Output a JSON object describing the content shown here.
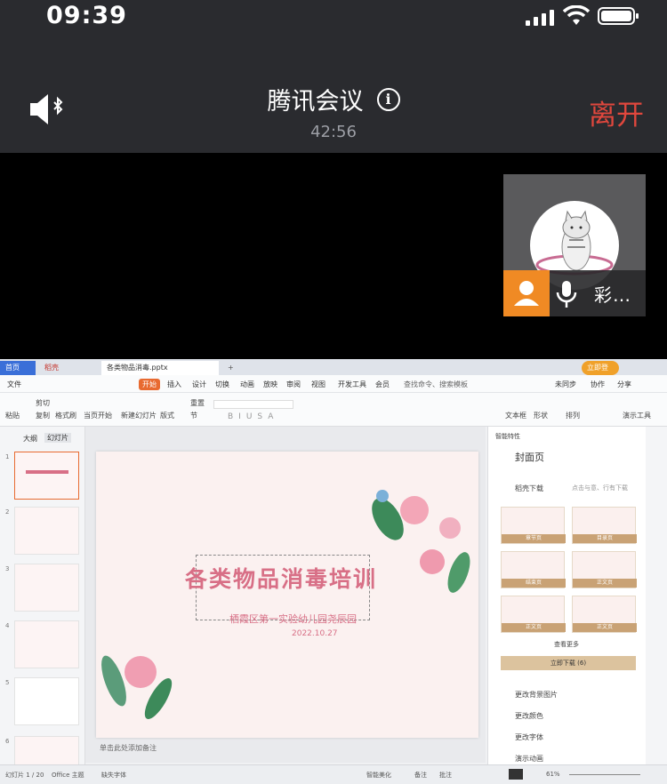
{
  "status_bar": {
    "time": "09:39"
  },
  "meeting": {
    "title": "腾讯会议",
    "info_glyph": "i",
    "duration": "42:56",
    "leave_label": "离开"
  },
  "participant": {
    "name": "彩…"
  },
  "wps": {
    "tabs": {
      "home": "首页",
      "daoke": "稻壳",
      "doc": "各类物品消毒.pptx",
      "add": "+",
      "login": "立即登录"
    },
    "menu": [
      "文件",
      "开始",
      "插入",
      "设计",
      "切换",
      "动画",
      "放映",
      "审阅",
      "视图",
      "开发工具",
      "会员"
    ],
    "search": "查找命令、搜索模板",
    "right_menu": [
      "未同步",
      "协作",
      "分享"
    ],
    "ribbon": [
      "粘贴",
      "剪切",
      "复制",
      "格式刷",
      "当页开始",
      "新建幻灯片",
      "版式",
      "节",
      "重置",
      "文本框",
      "形状",
      "排列",
      "演示工具"
    ],
    "view_tabs": [
      "大纲",
      "幻灯片"
    ],
    "slide": {
      "title": "各类物品消毒培训",
      "subtitle": "栖霞区第一实验幼儿园尧辰园",
      "date": "2022.10.27"
    },
    "notes_hint": "单击此处添加备注",
    "panel": {
      "heading": "智能特性",
      "section": "封面页",
      "filter": "稻壳下载",
      "filter_hint": "点击与意、行有下载",
      "cards": [
        "章节页",
        "目录页",
        "结束页",
        "正文页",
        "正文页",
        "正文页"
      ],
      "more": "查看更多",
      "download": "立即下载 (6)",
      "actions": [
        "更改背景图片",
        "更改颜色",
        "更改字体",
        "演示动画"
      ]
    },
    "status": {
      "slide_count": "幻灯片 1 / 20",
      "theme": "Office 主题",
      "font": "缺失字体",
      "smart": "智能美化",
      "notes": "备注",
      "comment": "批注",
      "zoom": "61%"
    }
  }
}
